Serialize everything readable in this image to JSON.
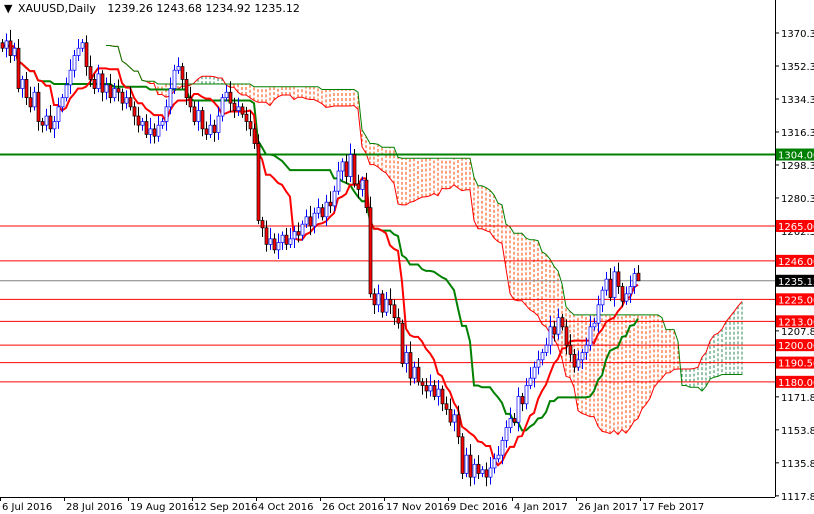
{
  "header": {
    "symbol": "XAUUSD,Daily",
    "ohlc": "1239.26 1243.68 1234.92 1235.12",
    "menu_icon": "triangle-down-icon"
  },
  "chart_data": {
    "type": "candlestick",
    "indicator": "Ichimoku Kinko Hyo",
    "colors": {
      "bull_candle": "#0000ff",
      "bear_candle": "#ff0000",
      "tenkan": "#ff0000",
      "kijun": "#008000",
      "cloud_bearish": "#ff4500",
      "cloud_bullish": "#2e8b57",
      "support_resistance": "#ff0000",
      "key_level": "#008000",
      "price_line": "#808080"
    },
    "ylim": [
      1117.8,
      1379
    ],
    "y_ticks": [
      "1370.30",
      "1352.30",
      "1334.30",
      "1316.30",
      "1298.30",
      "1280.30",
      "1262.30",
      "1207.80",
      "1171.80",
      "1153.80",
      "1135.80",
      "1117.80"
    ],
    "x_ticks": [
      {
        "bar": 0,
        "label": "6 Jul 2016"
      },
      {
        "bar": 16,
        "label": "28 Jul 2016"
      },
      {
        "bar": 32,
        "label": "19 Aug 2016"
      },
      {
        "bar": 48,
        "label": "12 Sep 2016"
      },
      {
        "bar": 64,
        "label": "4 Oct 2016"
      },
      {
        "bar": 80,
        "label": "26 Oct 2016"
      },
      {
        "bar": 96,
        "label": "17 Nov 2016"
      },
      {
        "bar": 112,
        "label": "9 Dec 2016"
      },
      {
        "bar": 128,
        "label": "4 Jan 2017"
      },
      {
        "bar": 144,
        "label": "26 Jan 2017"
      },
      {
        "bar": 160,
        "label": "17 Feb 2017"
      }
    ],
    "closes": [
      1362,
      1366,
      1358,
      1362,
      1340,
      1345,
      1335,
      1330,
      1338,
      1322,
      1320,
      1325,
      1318,
      1322,
      1330,
      1335,
      1342,
      1350,
      1358,
      1362,
      1365,
      1352,
      1345,
      1340,
      1348,
      1338,
      1342,
      1335,
      1340,
      1338,
      1332,
      1335,
      1330,
      1325,
      1320,
      1322,
      1315,
      1318,
      1314,
      1320,
      1322,
      1330,
      1340,
      1350,
      1352,
      1345,
      1335,
      1330,
      1322,
      1328,
      1318,
      1315,
      1320,
      1316,
      1325,
      1335,
      1338,
      1332,
      1328,
      1330,
      1326,
      1322,
      1318,
      1310,
      1268,
      1264,
      1255,
      1258,
      1252,
      1256,
      1260,
      1255,
      1258,
      1262,
      1260,
      1266,
      1270,
      1265,
      1272,
      1275,
      1270,
      1278,
      1276,
      1284,
      1295,
      1300,
      1292,
      1304,
      1288,
      1285,
      1290,
      1275,
      1228,
      1222,
      1228,
      1218,
      1225,
      1222,
      1215,
      1212,
      1190,
      1196,
      1182,
      1188,
      1180,
      1178,
      1175,
      1178,
      1172,
      1176,
      1168,
      1165,
      1158,
      1162,
      1150,
      1130,
      1140,
      1128,
      1135,
      1130,
      1132,
      1128,
      1133,
      1138,
      1140,
      1148,
      1155,
      1160,
      1158,
      1172,
      1168,
      1178,
      1182,
      1188,
      1192,
      1196,
      1200,
      1210,
      1206,
      1215,
      1210,
      1200,
      1195,
      1188,
      1192,
      1196,
      1200,
      1210,
      1212,
      1222,
      1230,
      1236,
      1226,
      1240,
      1232,
      1224,
      1228,
      1232,
      1239,
      1235.12
    ],
    "last_bar": {
      "open": 1239.26,
      "high": 1243.68,
      "low": 1234.92,
      "close": 1235.12
    },
    "levels": [
      {
        "value": 1304.0,
        "label": "1304.00",
        "color": "#008000"
      },
      {
        "value": 1265.0,
        "label": "1265.00",
        "color": "#ff0000"
      },
      {
        "value": 1246.0,
        "label": "1246.00",
        "color": "#ff0000"
      },
      {
        "value": 1225.0,
        "label": "1225.00",
        "color": "#ff0000"
      },
      {
        "value": 1213.0,
        "label": "1213.00",
        "color": "#ff0000"
      },
      {
        "value": 1200.0,
        "label": "1200.00",
        "color": "#ff0000"
      },
      {
        "value": 1190.5,
        "label": "1190.50",
        "color": "#ff0000"
      },
      {
        "value": 1180.0,
        "label": "1180.00",
        "color": "#ff0000"
      }
    ],
    "current_price": {
      "value": 1235.12,
      "label": "1235.12"
    }
  }
}
